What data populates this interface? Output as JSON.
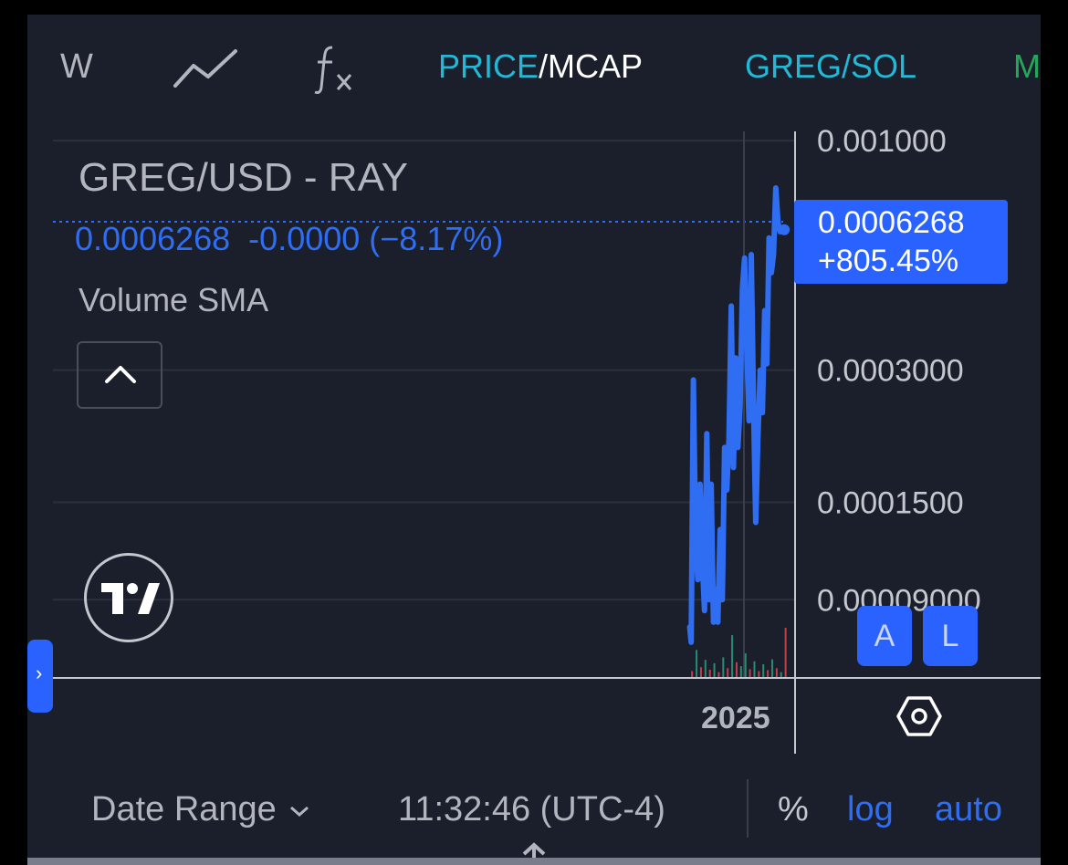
{
  "toolbar": {
    "interval": "W",
    "price_label": "PRICE",
    "mcap_label": "/MCAP",
    "pair_label": "GREG/SOL",
    "more_label": "M",
    "chart_type_icon": "line-chart-icon",
    "indicators_icon": "fx-icon"
  },
  "legend": {
    "title": "GREG/USD - RAY",
    "price_line": "0.0006268  -0.0000 (−8.17%)",
    "indicator": "Volume SMA"
  },
  "price_tag": {
    "price": "0.0006268",
    "change": "+805.45%"
  },
  "scale_buttons": {
    "a": "A",
    "l": "L"
  },
  "time_axis": {
    "label": "2025"
  },
  "bottom_bar": {
    "date_range": "Date Range",
    "clock": "11:32:46 (UTC-4)",
    "percent": "%",
    "log": "log",
    "auto": "auto"
  },
  "colors": {
    "background": "#1b1f2b",
    "line": "#2f6ef2",
    "accent": "#2962ff",
    "toolbar_highlight": "#22b8d6"
  },
  "chart_data": {
    "type": "line",
    "scale": "log",
    "title": "GREG/USD - RAY",
    "ylim": [
      6e-05,
      0.00108
    ],
    "y_ticks": [
      "0.001000",
      "0.0003000",
      "0.0001500",
      "0.00009000"
    ],
    "y_tick_values": [
      0.001,
      0.0003,
      0.00015,
      9e-05
    ],
    "last_value": 0.0006268,
    "x_start": 0.0,
    "x_end": 1.0,
    "x_tick": {
      "label": "2025",
      "at": 0.935
    },
    "series": [
      {
        "values": [
          [
            0.858,
            7.8e-05
          ],
          [
            0.86,
            7.2e-05
          ],
          [
            0.863,
            0.000285
          ],
          [
            0.866,
            0.00012
          ],
          [
            0.869,
            0.0001
          ],
          [
            0.872,
            0.000165
          ],
          [
            0.875,
            0.00011
          ],
          [
            0.878,
            8.5e-05
          ],
          [
            0.881,
            0.000215
          ],
          [
            0.884,
            9e-05
          ],
          [
            0.887,
            0.000165
          ],
          [
            0.89,
            8e-05
          ],
          [
            0.893,
            9.5e-05
          ],
          [
            0.896,
            8e-05
          ],
          [
            0.899,
            0.00013
          ],
          [
            0.902,
            9e-05
          ],
          [
            0.905,
            0.0002
          ],
          [
            0.908,
            0.00016
          ],
          [
            0.911,
            0.00021
          ],
          [
            0.914,
            0.00042
          ],
          [
            0.917,
            0.00018
          ],
          [
            0.92,
            0.00032
          ],
          [
            0.923,
            0.0002
          ],
          [
            0.926,
            0.00025
          ],
          [
            0.929,
            0.00046
          ],
          [
            0.932,
            0.00054
          ],
          [
            0.935,
            0.00033
          ],
          [
            0.938,
            0.00023
          ],
          [
            0.941,
            0.00055
          ],
          [
            0.944,
            0.00025
          ],
          [
            0.947,
            0.000135
          ],
          [
            0.95,
            0.00021
          ],
          [
            0.953,
            0.0003
          ],
          [
            0.956,
            0.00024
          ],
          [
            0.959,
            0.00041
          ],
          [
            0.962,
            0.00031
          ],
          [
            0.965,
            0.0006
          ],
          [
            0.968,
            0.0005
          ],
          [
            0.971,
            0.00055
          ],
          [
            0.974,
            0.00078
          ],
          [
            0.977,
            0.00065
          ],
          [
            0.98,
            0.00062
          ],
          [
            0.983,
            0.000627
          ]
        ]
      }
    ],
    "volume": [
      {
        "x": 0.86,
        "v": 0.12,
        "c": "red"
      },
      {
        "x": 0.866,
        "v": 0.55,
        "c": "green"
      },
      {
        "x": 0.872,
        "v": 0.2,
        "c": "red"
      },
      {
        "x": 0.878,
        "v": 0.35,
        "c": "green"
      },
      {
        "x": 0.884,
        "v": 0.15,
        "c": "red"
      },
      {
        "x": 0.89,
        "v": 0.28,
        "c": "green"
      },
      {
        "x": 0.896,
        "v": 0.1,
        "c": "red"
      },
      {
        "x": 0.902,
        "v": 0.4,
        "c": "green"
      },
      {
        "x": 0.908,
        "v": 0.18,
        "c": "red"
      },
      {
        "x": 0.914,
        "v": 0.85,
        "c": "green"
      },
      {
        "x": 0.92,
        "v": 0.3,
        "c": "red"
      },
      {
        "x": 0.926,
        "v": 0.22,
        "c": "green"
      },
      {
        "x": 0.932,
        "v": 0.48,
        "c": "green"
      },
      {
        "x": 0.938,
        "v": 0.16,
        "c": "red"
      },
      {
        "x": 0.944,
        "v": 0.32,
        "c": "green"
      },
      {
        "x": 0.95,
        "v": 0.12,
        "c": "red"
      },
      {
        "x": 0.956,
        "v": 0.26,
        "c": "green"
      },
      {
        "x": 0.962,
        "v": 0.14,
        "c": "red"
      },
      {
        "x": 0.968,
        "v": 0.36,
        "c": "green"
      },
      {
        "x": 0.974,
        "v": 0.18,
        "c": "red"
      },
      {
        "x": 0.98,
        "v": 0.1,
        "c": "green"
      },
      {
        "x": 0.986,
        "v": 1.0,
        "c": "red"
      }
    ]
  }
}
